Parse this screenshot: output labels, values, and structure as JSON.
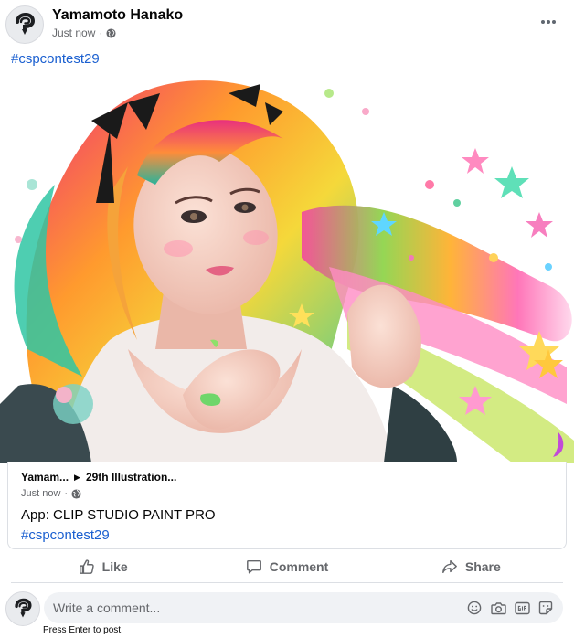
{
  "post": {
    "author": "Yamamoto Hanako",
    "time": "Just now",
    "dot": "·",
    "hashtag": "#cspcontest29",
    "avatar_icon": "clip-studio-logo-icon",
    "more_icon": "more-horizontal-icon"
  },
  "link_card": {
    "crumb_author": "Yamam...",
    "crumb_arrow": "▶",
    "crumb_group": "29th Illustration...",
    "time": "Just now",
    "dot": "·",
    "app_line": "App: CLIP STUDIO PAINT PRO",
    "hashtag": "#cspcontest29"
  },
  "actions": [
    {
      "label": "Like",
      "icon": "thumbs-up-icon"
    },
    {
      "label": "Comment",
      "icon": "comment-bubble-icon"
    },
    {
      "label": "Share",
      "icon": "share-arrow-icon"
    }
  ],
  "comment": {
    "placeholder": "Write a comment...",
    "hint": "Press Enter to post.",
    "icons": [
      "emoji-icon",
      "camera-icon",
      "gif-icon",
      "sticker-icon"
    ]
  },
  "colors": {
    "link": "#1a5fd0",
    "muted": "#65676b",
    "border": "#dcdfe4",
    "input_bg": "#f0f2f5"
  }
}
